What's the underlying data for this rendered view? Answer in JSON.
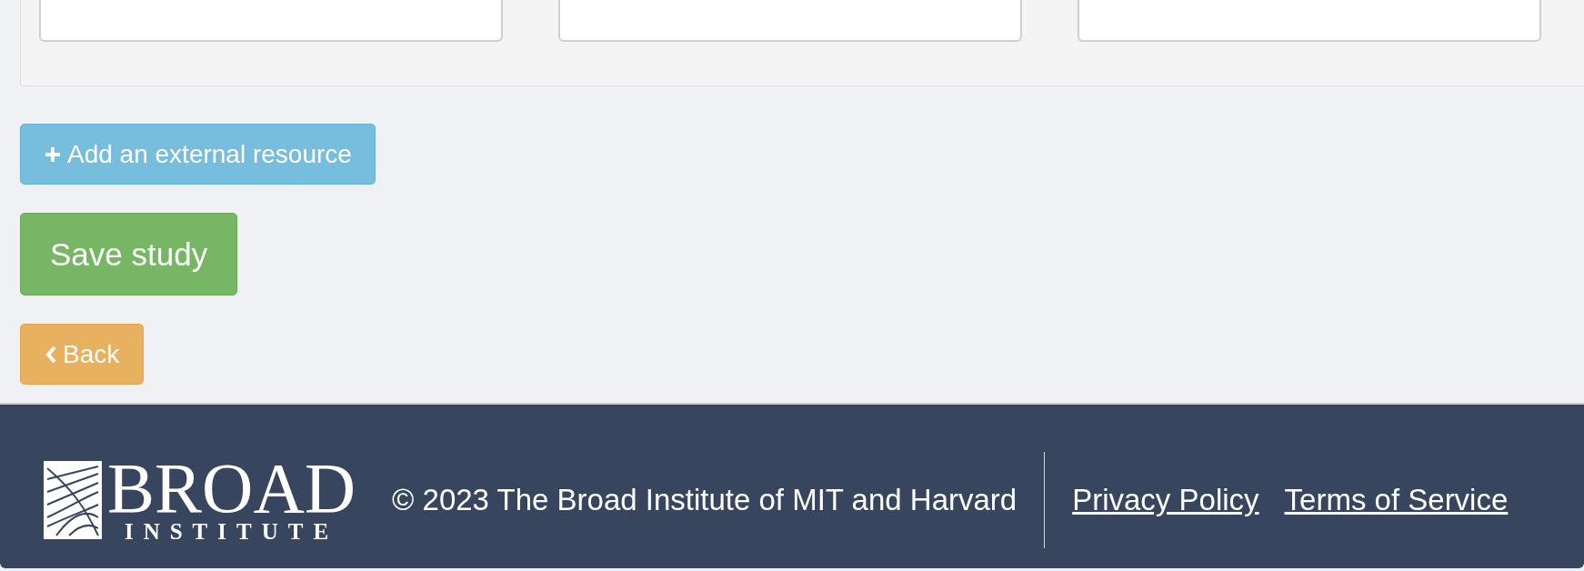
{
  "form_panel": {
    "cards": [
      {
        "kind": "field"
      },
      {
        "kind": "field"
      },
      {
        "kind": "field"
      }
    ]
  },
  "buttons": [
    {
      "kind": "add",
      "label": "Add an external resource"
    },
    {
      "kind": "save",
      "label": "Save study"
    },
    {
      "kind": "back",
      "label": "Back"
    }
  ],
  "footer": {
    "logo": {
      "name": "BROAD",
      "subtitle": "INSTITUTE"
    },
    "copyright": "© 2023 The Broad Institute of MIT and Harvard",
    "links": [
      "Privacy Policy",
      "Terms of Service"
    ]
  }
}
